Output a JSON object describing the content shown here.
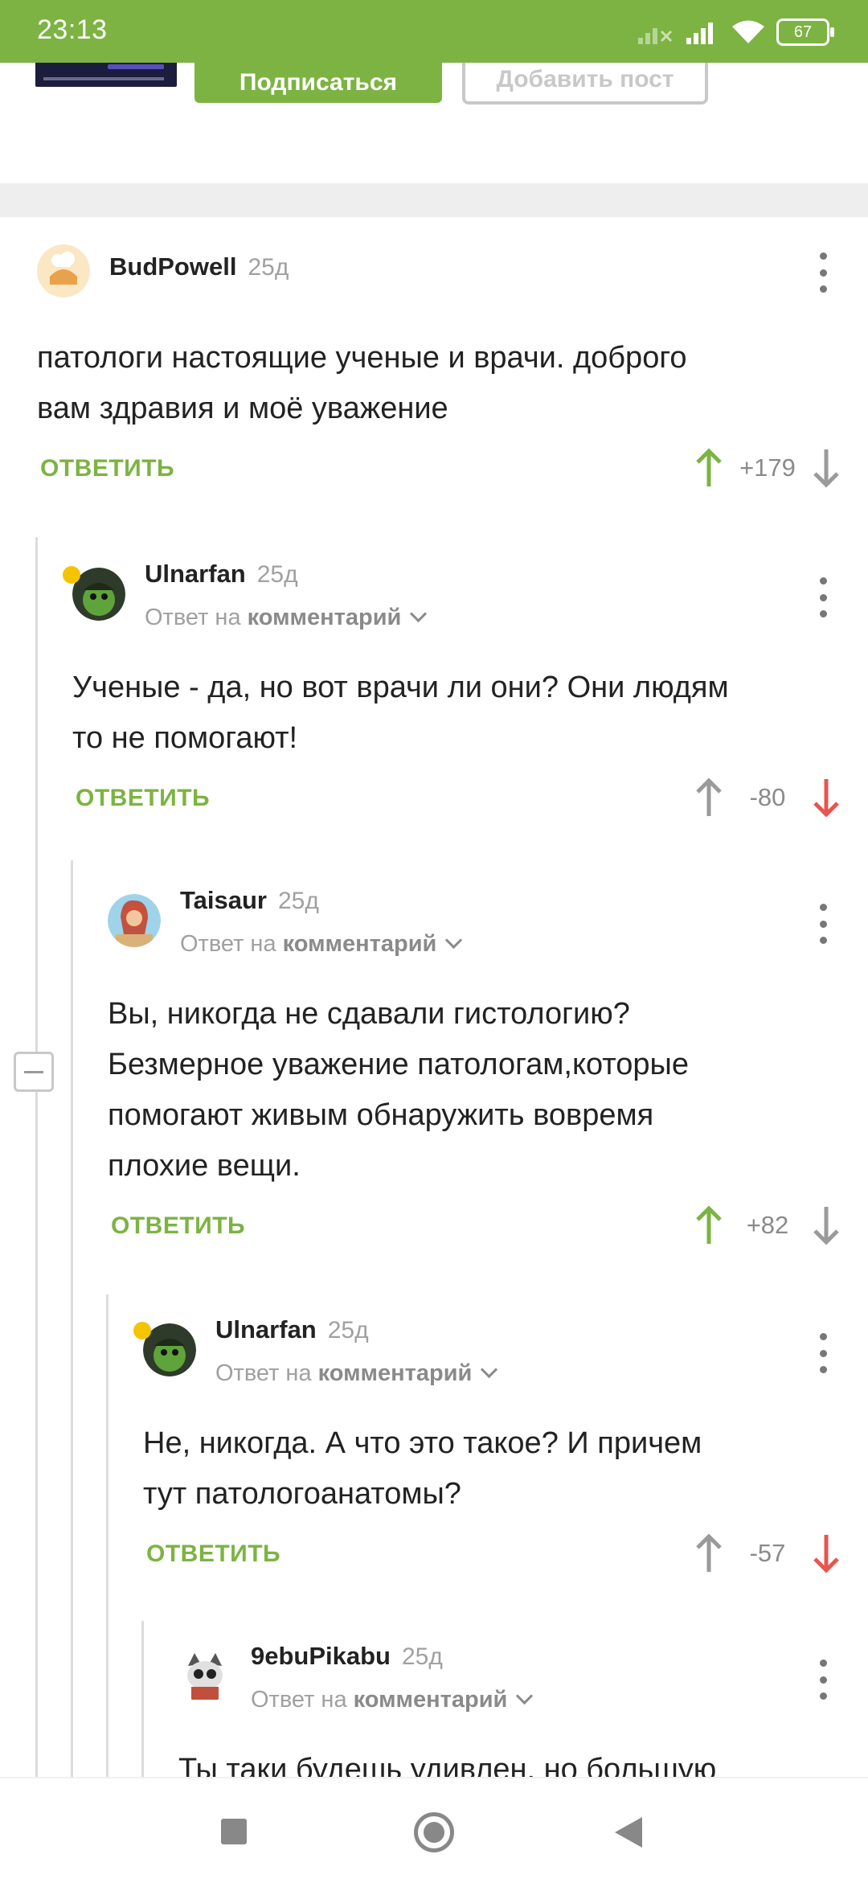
{
  "status_bar": {
    "time": "23:13",
    "battery": "67"
  },
  "header": {
    "subscribe_label": "Подписаться",
    "add_post_label": "Добавить пост"
  },
  "colors": {
    "accent": "#7cb342",
    "downvote": "#e8554f",
    "muted": "#a0a0a0"
  },
  "comments": [
    {
      "author": "BudPowell",
      "age": "25д",
      "reply_to": null,
      "text": [
        "патологи настоящие ученые и врачи. доброго",
        "вам здравия и моё уважение"
      ],
      "reply_label": "ОТВЕТИТЬ",
      "score": "+179",
      "vote": "up"
    },
    {
      "author": "Ulnarfan",
      "age": "25д",
      "reply_prefix": "Ответ на",
      "reply_target": "комментарий",
      "text": [
        "Ученые - да, но вот врачи ли они? Они людям",
        "то не помогают!"
      ],
      "reply_label": "ОТВЕТИТЬ",
      "score": "-80",
      "vote": "down"
    },
    {
      "author": "Taisaur",
      "age": "25д",
      "reply_prefix": "Ответ на",
      "reply_target": "комментарий",
      "text": [
        "Вы, никогда не сдавали гистологию?",
        "Безмерное уважение патологам,которые",
        "помогают живым обнаружить вовремя",
        "плохие вещи."
      ],
      "reply_label": "ОТВЕТИТЬ",
      "score": "+82",
      "vote": "up"
    },
    {
      "author": "Ulnarfan",
      "age": "25д",
      "reply_prefix": "Ответ на",
      "reply_target": "комментарий",
      "text": [
        "Не, никогда. А что это такое? И причем",
        "тут патологоанатомы?"
      ],
      "reply_label": "ОТВЕТИТЬ",
      "score": "-57",
      "vote": "down"
    },
    {
      "author": "9ebuPikabu",
      "age": "25д",
      "reply_prefix": "Ответ на",
      "reply_target": "комментарий",
      "text": [
        "Ты таки будешь удивлен, но большую"
      ]
    }
  ]
}
